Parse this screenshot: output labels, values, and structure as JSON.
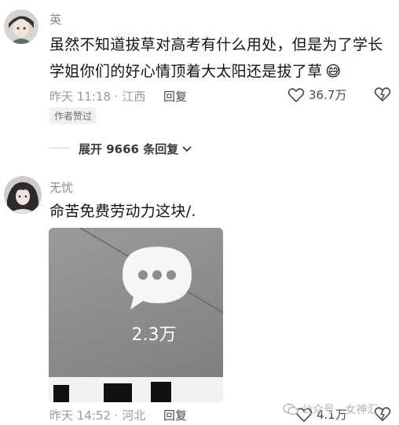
{
  "comments": [
    {
      "username": "英",
      "text_line1": "虽然不知道拔草对高考有什么用处，但是为了学长",
      "text_line2": "学姐你们的好心情顶着大太阳还是拔了草",
      "emoji": "😅",
      "time": "昨天 11:18",
      "location": "江西",
      "reply_label": "回复",
      "likes": "36.7万",
      "author_badge": "作者赞过",
      "expand_label": "展开 9666 条回复"
    },
    {
      "username": "无忧",
      "text": "命苦免费劳动力这块/.",
      "card_count": "2.3万",
      "time": "昨天 14:52",
      "location": "河北",
      "reply_label": "回复",
      "likes": "4.1万"
    }
  ],
  "watermark": "公众号 · 女神汇"
}
